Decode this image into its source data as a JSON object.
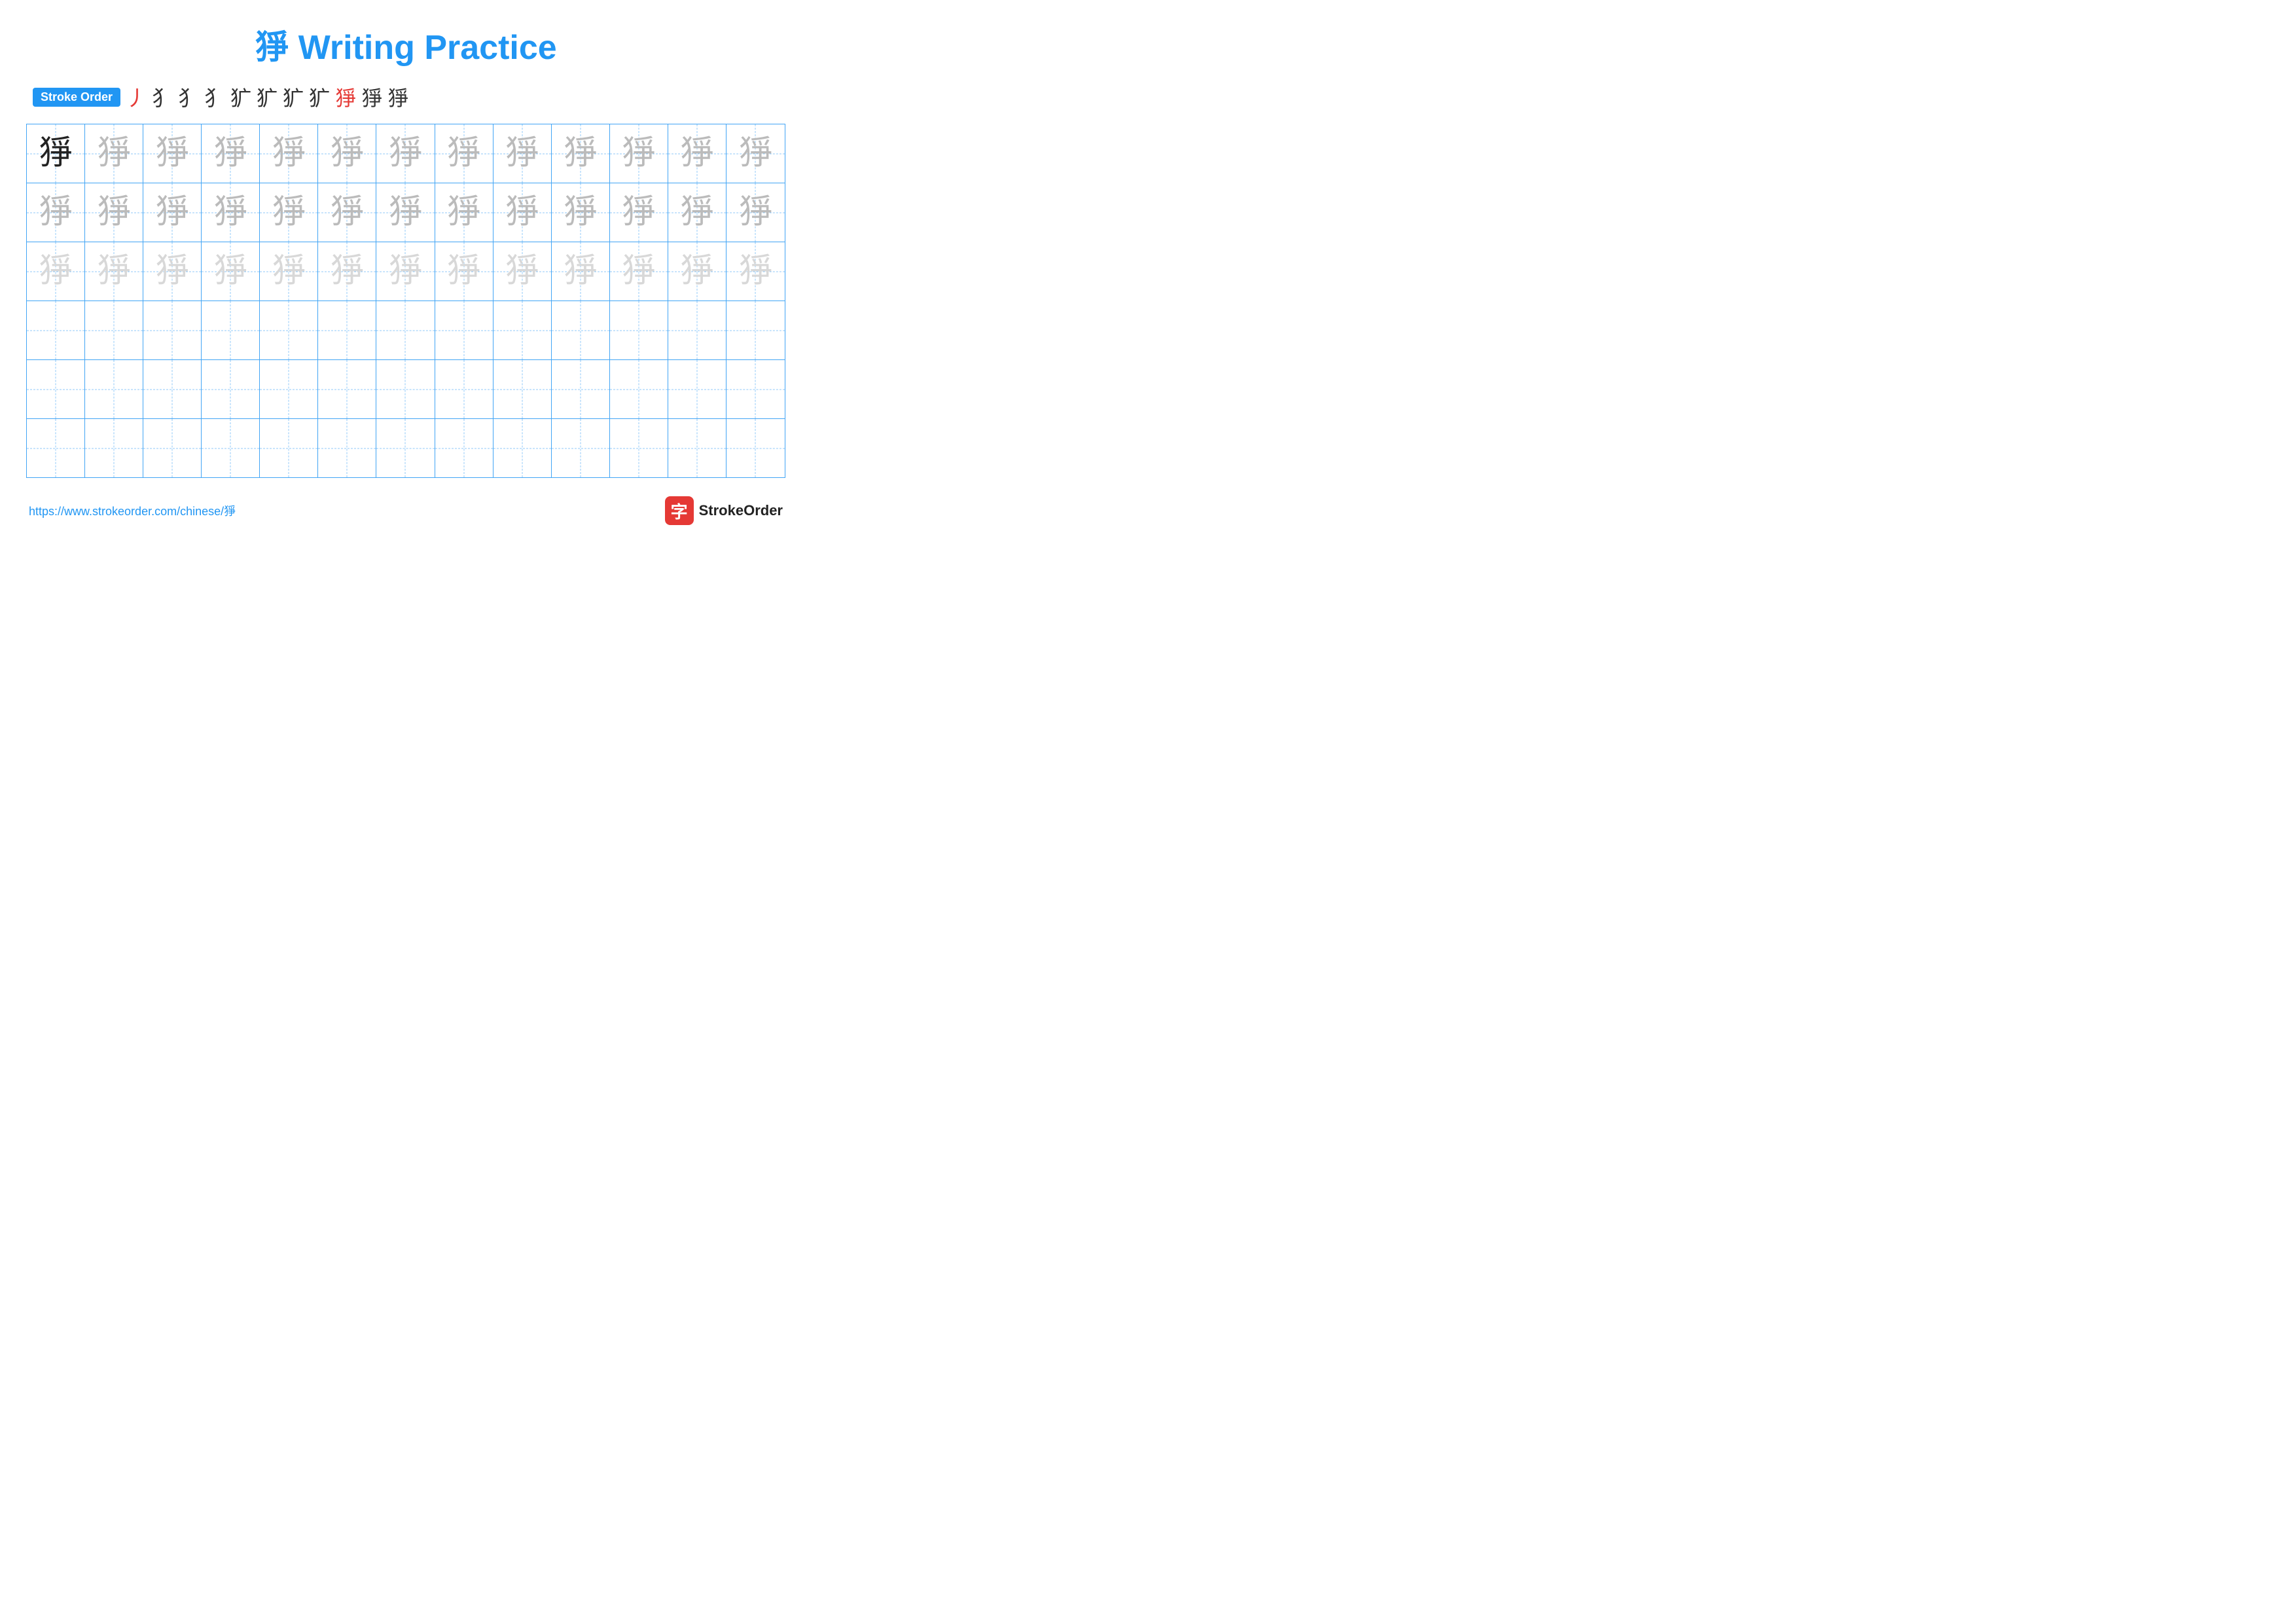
{
  "title": "猙 Writing Practice",
  "stroke_order": {
    "label": "Stroke Order",
    "strokes": [
      "丿",
      "犭",
      "犭",
      "犭",
      "犷",
      "犷",
      "犷",
      "犷",
      "猙",
      "猙",
      "猙"
    ]
  },
  "character": "猙",
  "grid": {
    "rows": 6,
    "cols": 13,
    "row_data": [
      {
        "type": "row1",
        "cells": [
          {
            "char": "猙",
            "style": "dark"
          },
          {
            "char": "猙",
            "style": "medium"
          },
          {
            "char": "猙",
            "style": "medium"
          },
          {
            "char": "猙",
            "style": "medium"
          },
          {
            "char": "猙",
            "style": "medium"
          },
          {
            "char": "猙",
            "style": "medium"
          },
          {
            "char": "猙",
            "style": "medium"
          },
          {
            "char": "猙",
            "style": "medium"
          },
          {
            "char": "猙",
            "style": "medium"
          },
          {
            "char": "猙",
            "style": "medium"
          },
          {
            "char": "猙",
            "style": "medium"
          },
          {
            "char": "猙",
            "style": "medium"
          },
          {
            "char": "猙",
            "style": "medium"
          }
        ]
      },
      {
        "type": "row2",
        "cells": [
          {
            "char": "猙",
            "style": "medium"
          },
          {
            "char": "猙",
            "style": "medium"
          },
          {
            "char": "猙",
            "style": "medium"
          },
          {
            "char": "猙",
            "style": "medium"
          },
          {
            "char": "猙",
            "style": "medium"
          },
          {
            "char": "猙",
            "style": "medium"
          },
          {
            "char": "猙",
            "style": "medium"
          },
          {
            "char": "猙",
            "style": "medium"
          },
          {
            "char": "猙",
            "style": "medium"
          },
          {
            "char": "猙",
            "style": "medium"
          },
          {
            "char": "猙",
            "style": "medium"
          },
          {
            "char": "猙",
            "style": "medium"
          },
          {
            "char": "猙",
            "style": "medium"
          }
        ]
      },
      {
        "type": "row3",
        "cells": [
          {
            "char": "猙",
            "style": "light"
          },
          {
            "char": "猙",
            "style": "light"
          },
          {
            "char": "猙",
            "style": "light"
          },
          {
            "char": "猙",
            "style": "light"
          },
          {
            "char": "猙",
            "style": "light"
          },
          {
            "char": "猙",
            "style": "light"
          },
          {
            "char": "猙",
            "style": "light"
          },
          {
            "char": "猙",
            "style": "light"
          },
          {
            "char": "猙",
            "style": "light"
          },
          {
            "char": "猙",
            "style": "light"
          },
          {
            "char": "猙",
            "style": "light"
          },
          {
            "char": "猙",
            "style": "light"
          },
          {
            "char": "猙",
            "style": "light"
          }
        ]
      },
      {
        "type": "empty"
      },
      {
        "type": "empty"
      },
      {
        "type": "empty"
      }
    ]
  },
  "footer": {
    "url": "https://www.strokeorder.com/chinese/猙",
    "logo_text": "StrokeOrder",
    "logo_char": "字"
  }
}
